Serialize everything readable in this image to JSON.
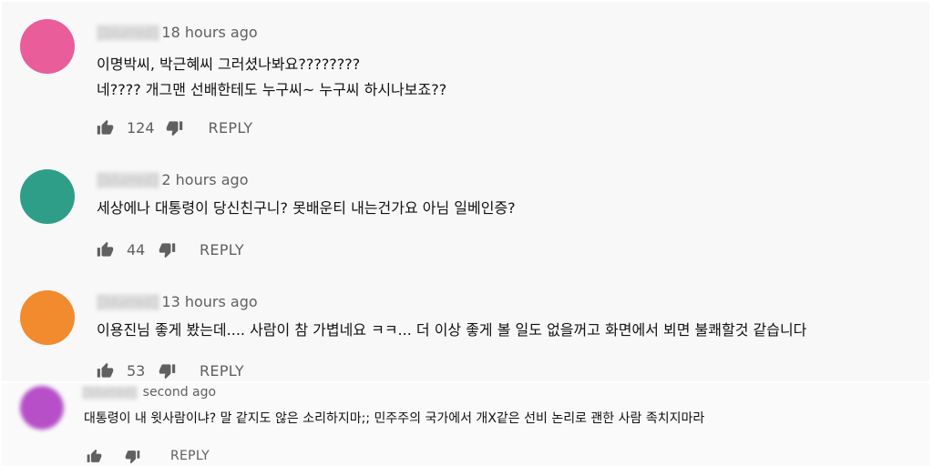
{
  "colors": {
    "avatar_1": "#e85d9a",
    "avatar_2": "#2f9e89",
    "avatar_3": "#f28a2e",
    "avatar_4": "#b64fc8",
    "text": "#111111",
    "muted": "#606060",
    "panel": "#f8f8f8"
  },
  "comments": [
    {
      "author": "[blurred]",
      "time": "18 hours ago",
      "lines": [
        "이명박씨, 박근혜씨 그러셨나봐요????????",
        "네???? 개그맨 선배한테도 누구씨~ 누구씨 하시나보죠??"
      ],
      "likes": "124",
      "reply": "REPLY",
      "like_icon": "thumbs-up-icon",
      "dislike_icon": "thumbs-down-icon"
    },
    {
      "author": "[blurred]",
      "time": "2 hours ago",
      "lines": [
        "세상에나 대통령이 당신친구니? 못배운티 내는건가요 아님 일베인증?"
      ],
      "likes": "44",
      "reply": "REPLY",
      "like_icon": "thumbs-up-icon",
      "dislike_icon": "thumbs-down-icon"
    },
    {
      "author": "[blurred]",
      "time": "13 hours ago",
      "lines": [
        "이용진님 좋게 봤는데.... 사람이 참 가볍네요 ㅋㅋ... 더 이상 좋게 볼 일도 없을꺼고 화면에서 뵈면 불쾌할것 같습니다"
      ],
      "likes": "53",
      "reply": "REPLY",
      "like_icon": "thumbs-up-icon",
      "dislike_icon": "thumbs-down-icon"
    },
    {
      "author": "[blurred]",
      "time": "second ago",
      "lines": [
        "대통령이 내 윗사람이냐? 말 같지도 않은 소리하지마;; 민주주의 국가에서 개X같은 선비 논리로 괜한 사람 족치지마라"
      ],
      "likes": "",
      "reply": "REPLY",
      "like_icon": "thumbs-up-icon",
      "dislike_icon": "thumbs-down-icon"
    }
  ]
}
